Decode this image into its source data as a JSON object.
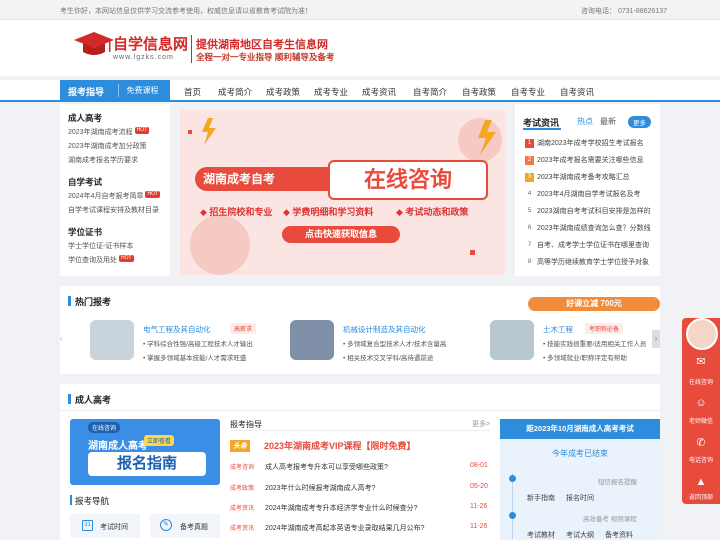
{
  "topbar": {
    "notice": "考生你好，本网站信息仅供学习交流参考使用，权威信息请以省教育考试院为准！",
    "phone": "咨询电话： 0731-88626137"
  },
  "header": {
    "logo_text": "自学信息网",
    "logo_url": "www.lgzks.com",
    "slogan1": "提供湖南地区自考生信息网",
    "slogan2": "全程一对一专业指导 顺利辅导及备考"
  },
  "nav": {
    "tab_main": "报考指导",
    "tab_sub": "免费课程",
    "items": [
      "首页",
      "成考简介",
      "成考政策",
      "成考专业",
      "成考资讯",
      "自考简介",
      "自考政策",
      "自考专业",
      "自考资讯"
    ]
  },
  "left_menu": {
    "sections": [
      {
        "title": "成人高考",
        "links": [
          {
            "text": "2023年湖南成考流程",
            "hot": true
          },
          {
            "text": "2023年湖南成考加分政策",
            "hot": false
          },
          {
            "text": "湖南成考报名学历要求",
            "hot": false
          }
        ]
      },
      {
        "title": "自学考试",
        "links": [
          {
            "text": "2024年4月自考报考简章",
            "hot": true
          },
          {
            "text": "自学考试课程安排及教材目录",
            "hot": false
          }
        ]
      },
      {
        "title": "学位证书",
        "links": [
          {
            "text": "学士学位证-证书样本",
            "hot": false
          },
          {
            "text": "学位查询及用处",
            "hot": true
          }
        ]
      }
    ],
    "hot_label": "HOT"
  },
  "banner": {
    "title_left": "湖南成考自考",
    "title_box": "在线咨询",
    "features": [
      "招生院校和专业",
      "学费明细和学习资料",
      "考试动态和政策"
    ],
    "button": "点击快速获取信息"
  },
  "news": {
    "title": "考试资讯",
    "tabs": [
      "热点",
      "最新"
    ],
    "more": "更多",
    "items": [
      "湖南2023年成考学校招生考试报名",
      "2023年成考报名需要关注哪些信息",
      "2023年湖南成考备考攻略汇总",
      "2023年4月湖南自学考试报名及考",
      "2023湖南自考考试科目安排是怎样的",
      "2023年湖南成绩查询怎么查？分数线",
      "自考、成考学士学位证书在哪里查询",
      "高等学历继续教育学士学位授予对象"
    ]
  },
  "hot_majors": {
    "title": "热门报考",
    "promo": "好课立减 700元",
    "cards": [
      {
        "title": "电气工程及其自动化",
        "tag": "高薪求",
        "lines": [
          "学科综合性强/高级工程技术人才输出",
          "掌握多领域基本技能/人才需求旺盛"
        ]
      },
      {
        "title": "机械设计制造及其自动化",
        "tag": "",
        "lines": [
          "多领域复合型技术人才/技术含量高",
          "相关技术交叉学科/高待遇前途"
        ]
      },
      {
        "title": "土木工程",
        "tag": "考职称必备",
        "lines": [
          "技能实践很重要/适用相关工作人员",
          "多领域就业/职称评定有帮助"
        ]
      }
    ]
  },
  "adult": {
    "title": "成人高考",
    "promo_banner": {
      "badge": "在线咨询",
      "line1": "湖南成人高考",
      "line2": "报名指南",
      "sticker": "立即查看"
    },
    "guide_title": "报考导航",
    "guide_items": [
      "考试时间",
      "备考真题"
    ],
    "center_title": "报考指导",
    "center_more": "更多>",
    "headline_tag": "头条",
    "headline": "2023年湖南成考VIP课程【限时免费】",
    "rows": [
      {
        "tag": "成考咨询",
        "text": "成人高考报考专升本可以享受哪些政策?",
        "date": "08-01"
      },
      {
        "tag": "成考政策",
        "text": "2023年什么时候报考湖南成人高考?",
        "date": "05-20"
      },
      {
        "tag": "成考资讯",
        "text": "2024年湖南成考专升本经济学专业什么时候查分?",
        "date": "11-26"
      },
      {
        "tag": "成考资讯",
        "text": "2024年湖南成考高起本英语专业录取结果几月公布?",
        "date": "11-26"
      }
    ],
    "countdown_title": "距2023年10月湖南成人高考考试",
    "countdown_status": "今年成考已结束",
    "right_rows": [
      {
        "left": "",
        "right": "短信报名提醒"
      },
      {
        "left": "新手指南",
        "right": "报名时间"
      },
      {
        "left": "",
        "right": "高效备考 视频课程"
      },
      {
        "left": "考试教材",
        "right": "考试大纲",
        "third": "备考资料"
      }
    ]
  },
  "side_bar": {
    "items": [
      "在线咨询",
      "老师微信",
      "电话咨询",
      "返回顶部"
    ]
  },
  "colors": {
    "brand_red": "#e84b3c",
    "nav_blue": "#2d8cdc"
  }
}
